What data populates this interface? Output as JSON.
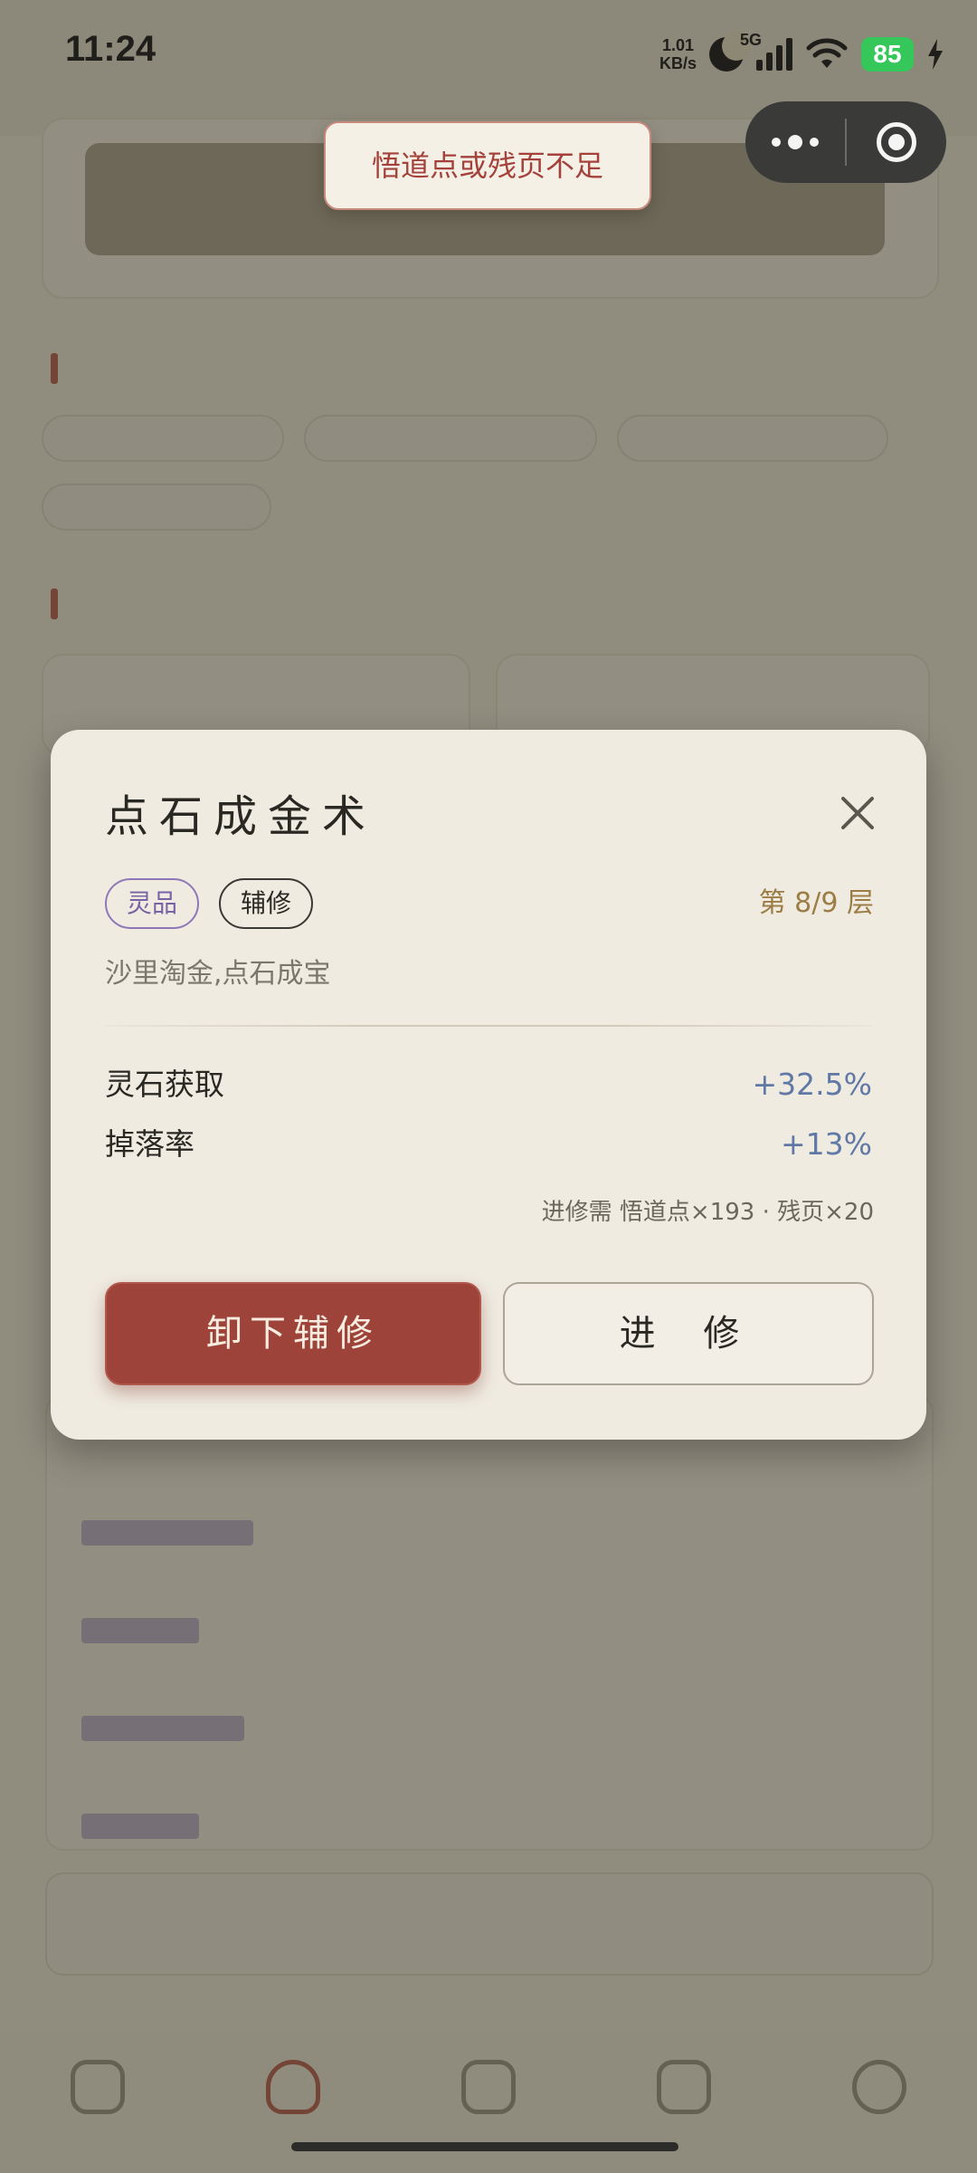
{
  "status_bar": {
    "time": "11:24",
    "net_speed_value": "1.01",
    "net_speed_unit": "KB/s",
    "network_type": "5G",
    "battery_level": "85"
  },
  "toast": {
    "message": "悟道点或残页不足"
  },
  "modal": {
    "title": "点石成金术",
    "grade_tag": "灵品",
    "role_tag": "辅修",
    "layer_info": "第 8/9 层",
    "description": "沙里淘金,点石成宝",
    "stats": [
      {
        "name": "灵石获取",
        "value": "+32.5%"
      },
      {
        "name": "掉落率",
        "value": "+13%"
      }
    ],
    "requirement": "进修需 悟道点×193 · 残页×20",
    "unequip_button": "卸下辅修",
    "advance_button": "进 修"
  },
  "colors": {
    "accent_red": "#9e4339",
    "grade_purple": "#7663a6",
    "stat_blue": "#5f78a6",
    "layer_gold": "#9c7d45",
    "battery_green": "#35c759"
  }
}
